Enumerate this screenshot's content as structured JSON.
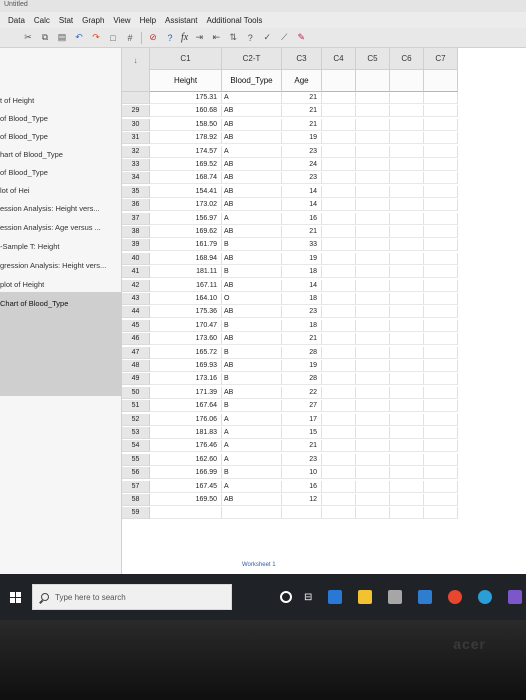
{
  "window": {
    "title": "Untitled"
  },
  "menu": [
    "Data",
    "Calc",
    "Stat",
    "Graph",
    "View",
    "Help",
    "Assistant",
    "Additional Tools"
  ],
  "toolbar": {
    "fx": "fx"
  },
  "nav": {
    "items": [
      "t of Height",
      "of Blood_Type",
      "of Blood_Type",
      "hart of Blood_Type",
      "of Blood_Type",
      "lot of Hei",
      "ession Analysis: Height vers...",
      "ession Analysis: Age versus ...",
      "-Sample T: Height",
      "gression Analysis: Height vers...",
      "plot of Height",
      "Chart of Blood_Type"
    ]
  },
  "sheet": {
    "columns": [
      {
        "id": "arrow",
        "head": "↓",
        "name": ""
      },
      {
        "id": "c1",
        "head": "C1",
        "name": "Height"
      },
      {
        "id": "c2",
        "head": "C2-T",
        "name": "Blood_Type"
      },
      {
        "id": "c3",
        "head": "C3",
        "name": "Age"
      },
      {
        "id": "c4",
        "head": "C4",
        "name": ""
      },
      {
        "id": "c5",
        "head": "C5",
        "name": ""
      },
      {
        "id": "c6",
        "head": "C6",
        "name": ""
      },
      {
        "id": "c7",
        "head": "C7",
        "name": ""
      }
    ],
    "rows": [
      {
        "n": "",
        "h": "175.31",
        "b": "A",
        "a": "21"
      },
      {
        "n": "29",
        "h": "160.68",
        "b": "AB",
        "a": "21"
      },
      {
        "n": "30",
        "h": "158.50",
        "b": "AB",
        "a": "21"
      },
      {
        "n": "31",
        "h": "178.92",
        "b": "AB",
        "a": "19"
      },
      {
        "n": "32",
        "h": "174.57",
        "b": "A",
        "a": "23"
      },
      {
        "n": "33",
        "h": "169.52",
        "b": "AB",
        "a": "24"
      },
      {
        "n": "34",
        "h": "168.74",
        "b": "AB",
        "a": "23"
      },
      {
        "n": "35",
        "h": "154.41",
        "b": "AB",
        "a": "14"
      },
      {
        "n": "36",
        "h": "173.02",
        "b": "AB",
        "a": "14"
      },
      {
        "n": "37",
        "h": "156.97",
        "b": "A",
        "a": "16"
      },
      {
        "n": "38",
        "h": "169.62",
        "b": "AB",
        "a": "21"
      },
      {
        "n": "39",
        "h": "161.79",
        "b": "B",
        "a": "33"
      },
      {
        "n": "40",
        "h": "168.94",
        "b": "AB",
        "a": "19"
      },
      {
        "n": "41",
        "h": "181.11",
        "b": "B",
        "a": "18"
      },
      {
        "n": "42",
        "h": "167.11",
        "b": "AB",
        "a": "14"
      },
      {
        "n": "43",
        "h": "164.10",
        "b": "O",
        "a": "18"
      },
      {
        "n": "44",
        "h": "175.36",
        "b": "AB",
        "a": "23"
      },
      {
        "n": "45",
        "h": "170.47",
        "b": "B",
        "a": "18"
      },
      {
        "n": "46",
        "h": "173.60",
        "b": "AB",
        "a": "21"
      },
      {
        "n": "47",
        "h": "165.72",
        "b": "B",
        "a": "28"
      },
      {
        "n": "48",
        "h": "169.93",
        "b": "AB",
        "a": "19"
      },
      {
        "n": "49",
        "h": "173.16",
        "b": "B",
        "a": "28"
      },
      {
        "n": "50",
        "h": "171.39",
        "b": "AB",
        "a": "22"
      },
      {
        "n": "51",
        "h": "167.64",
        "b": "B",
        "a": "27"
      },
      {
        "n": "52",
        "h": "176.06",
        "b": "A",
        "a": "17"
      },
      {
        "n": "53",
        "h": "181.83",
        "b": "A",
        "a": "15"
      },
      {
        "n": "54",
        "h": "176.46",
        "b": "A",
        "a": "21"
      },
      {
        "n": "55",
        "h": "162.60",
        "b": "A",
        "a": "23"
      },
      {
        "n": "56",
        "h": "166.99",
        "b": "B",
        "a": "10"
      },
      {
        "n": "57",
        "h": "167.45",
        "b": "A",
        "a": "16"
      },
      {
        "n": "58",
        "h": "169.50",
        "b": "AB",
        "a": "12"
      },
      {
        "n": "59",
        "h": "",
        "b": "",
        "a": ""
      }
    ],
    "worksheet_tab": "Worksheet 1"
  },
  "taskbar": {
    "search_placeholder": "Type here to search",
    "app_colors": [
      "#2a78d6",
      "#f2c230",
      "#a6a6a6",
      "#2f7dd1",
      "#e8462e",
      "#2a9fd6",
      "#7b57c9"
    ]
  },
  "bezel": {
    "brand": "acer"
  }
}
